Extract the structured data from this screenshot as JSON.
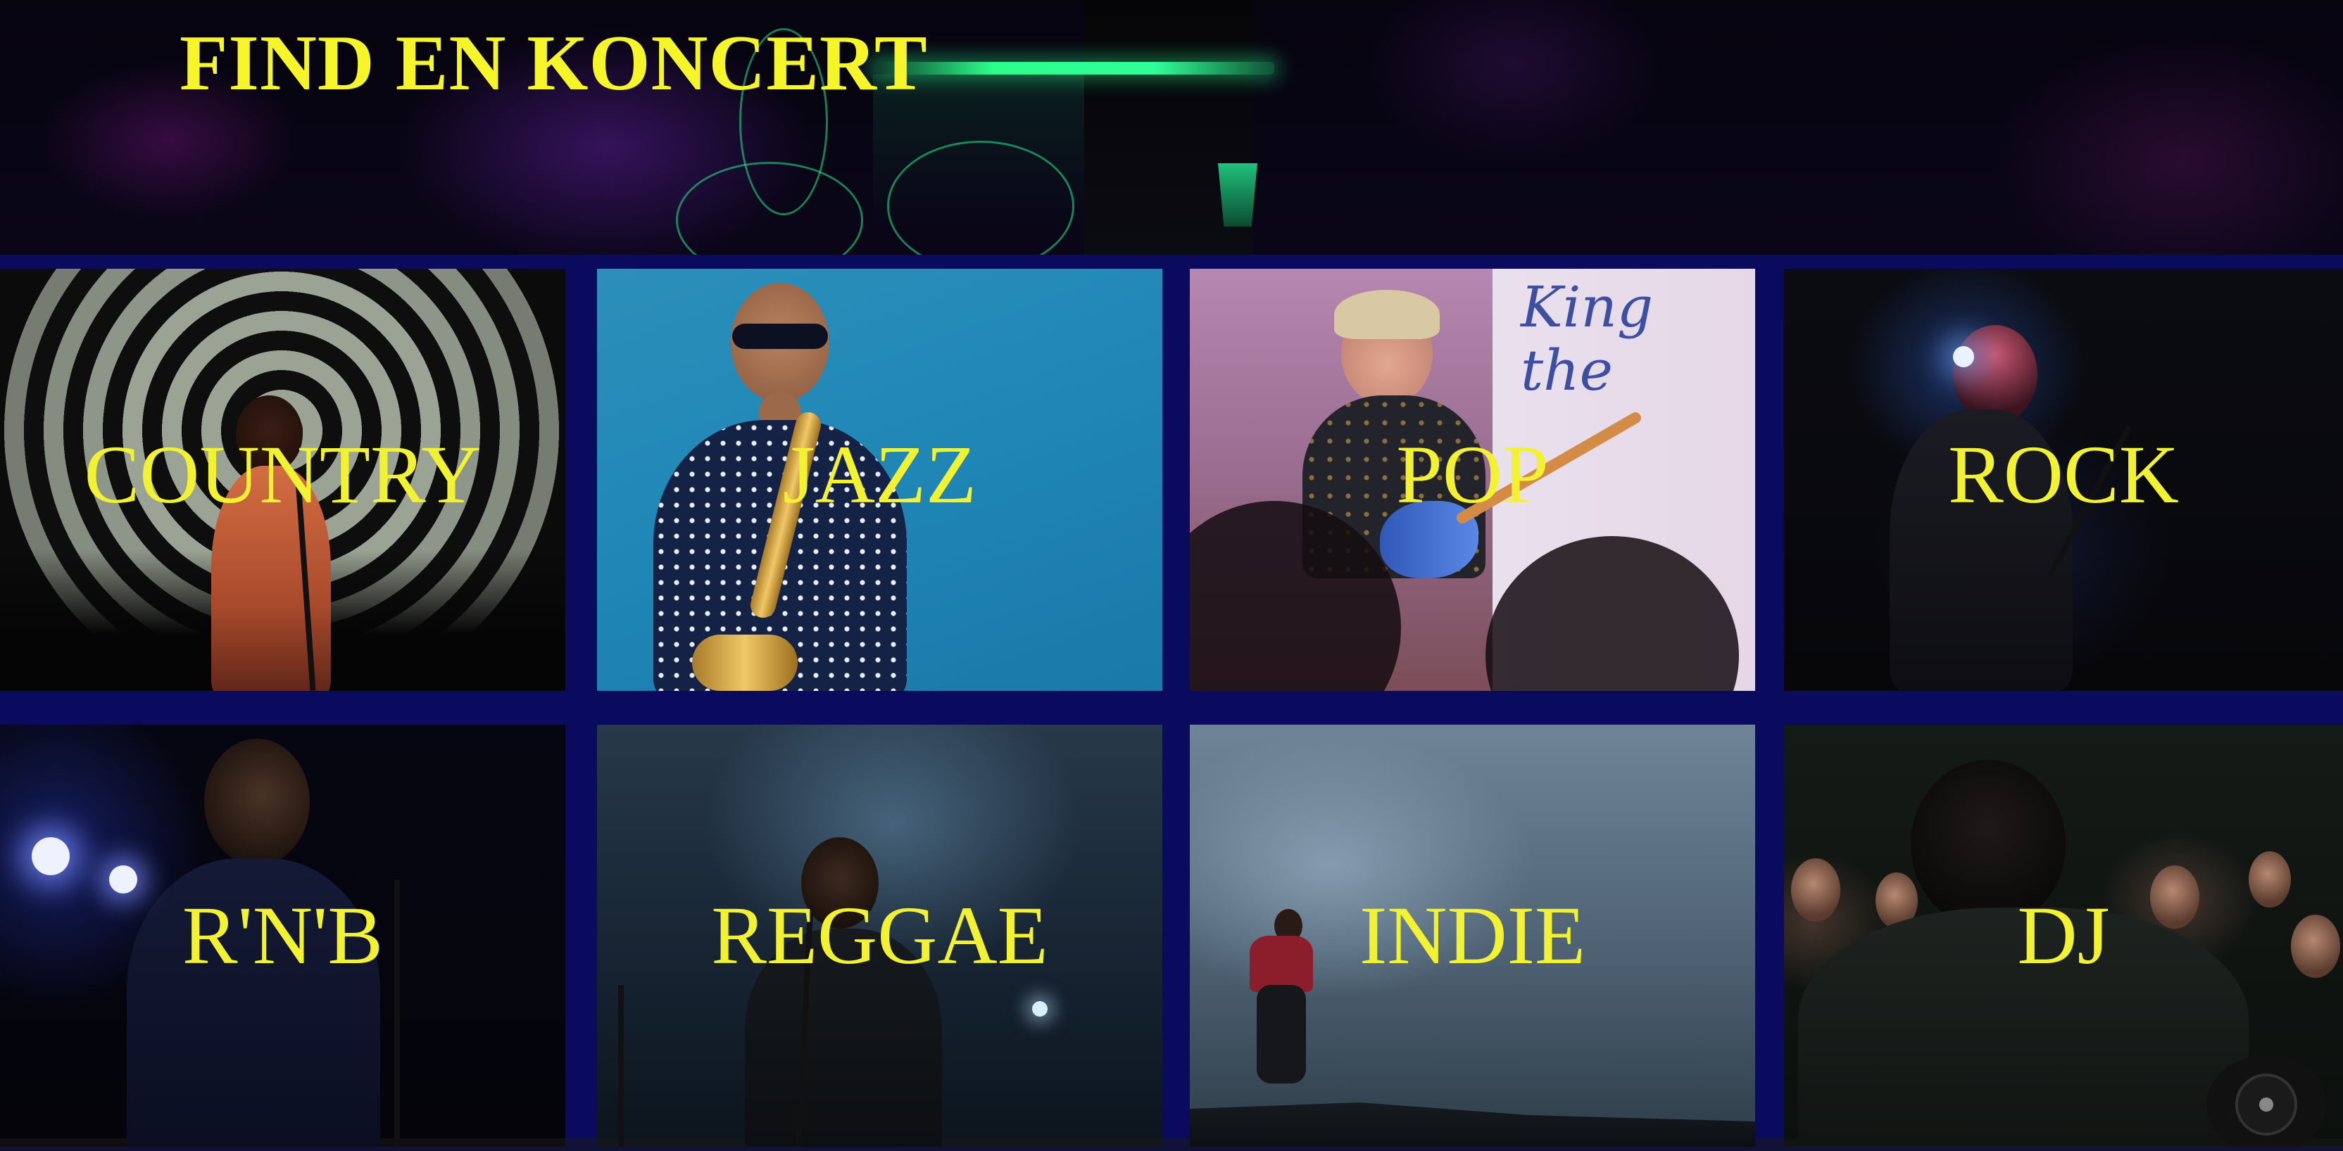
{
  "header": {
    "title": "FIND EN KONCERT"
  },
  "genres": [
    {
      "label": "COUNTRY"
    },
    {
      "label": "JAZZ"
    },
    {
      "label": "POP"
    },
    {
      "label": "ROCK"
    },
    {
      "label": "R'N'B"
    },
    {
      "label": "REGGAE"
    },
    {
      "label": "INDIE"
    },
    {
      "label": "DJ"
    }
  ],
  "pop_sign": {
    "line1": "King",
    "line2": "the"
  },
  "colors": {
    "page_background": "#0a0a5e",
    "title_text": "#f5f52a",
    "genre_text": "#f2f233"
  }
}
